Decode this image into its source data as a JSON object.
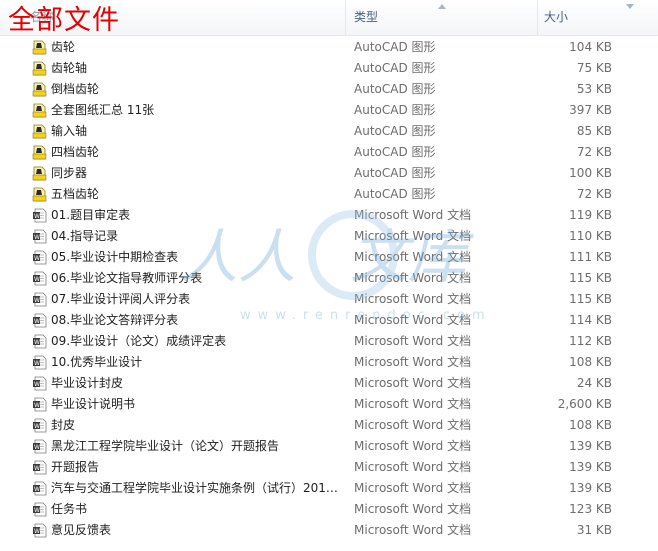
{
  "overlay_title": "全部文件",
  "columns": {
    "name": "名称",
    "type": "类型",
    "size": "大小"
  },
  "watermark": {
    "text_left": "人人",
    "text_right": "文库",
    "url": "www.renrendoc.com"
  },
  "files": [
    {
      "name": "齿轮",
      "type": "AutoCAD 图形",
      "size": "104 KB",
      "icon": "autocad-file-icon"
    },
    {
      "name": "齿轮轴",
      "type": "AutoCAD 图形",
      "size": "75 KB",
      "icon": "autocad-file-icon"
    },
    {
      "name": "倒档齿轮",
      "type": "AutoCAD 图形",
      "size": "53 KB",
      "icon": "autocad-file-icon"
    },
    {
      "name": "全套图纸汇总 11张",
      "type": "AutoCAD 图形",
      "size": "397 KB",
      "icon": "autocad-file-icon"
    },
    {
      "name": "输入轴",
      "type": "AutoCAD 图形",
      "size": "85 KB",
      "icon": "autocad-file-icon"
    },
    {
      "name": "四档齿轮",
      "type": "AutoCAD 图形",
      "size": "72 KB",
      "icon": "autocad-file-icon"
    },
    {
      "name": "同步器",
      "type": "AutoCAD 图形",
      "size": "100 KB",
      "icon": "autocad-file-icon"
    },
    {
      "name": "五档齿轮",
      "type": "AutoCAD 图形",
      "size": "72 KB",
      "icon": "autocad-file-icon"
    },
    {
      "name": "01.题目审定表",
      "type": "Microsoft Word 文档",
      "size": "119 KB",
      "icon": "word-file-icon"
    },
    {
      "name": "04.指导记录",
      "type": "Microsoft Word 文档",
      "size": "110 KB",
      "icon": "word-file-icon"
    },
    {
      "name": "05.毕业设计中期检查表",
      "type": "Microsoft Word 文档",
      "size": "111 KB",
      "icon": "word-file-icon"
    },
    {
      "name": "06.毕业论文指导教师评分表",
      "type": "Microsoft Word 文档",
      "size": "115 KB",
      "icon": "word-file-icon"
    },
    {
      "name": "07.毕业设计评阅人评分表",
      "type": "Microsoft Word 文档",
      "size": "115 KB",
      "icon": "word-file-icon"
    },
    {
      "name": "08.毕业论文答辩评分表",
      "type": "Microsoft Word 文档",
      "size": "114 KB",
      "icon": "word-file-icon"
    },
    {
      "name": "09.毕业设计（论文）成绩评定表",
      "type": "Microsoft Word 文档",
      "size": "112 KB",
      "icon": "word-file-icon"
    },
    {
      "name": "10.优秀毕业设计",
      "type": "Microsoft Word 文档",
      "size": "108 KB",
      "icon": "word-file-icon"
    },
    {
      "name": "毕业设计封皮",
      "type": "Microsoft Word 文档",
      "size": "24 KB",
      "icon": "word-file-icon"
    },
    {
      "name": "毕业设计说明书",
      "type": "Microsoft Word 文档",
      "size": "2,600 KB",
      "icon": "word-file-icon"
    },
    {
      "name": "封皮",
      "type": "Microsoft Word 文档",
      "size": "108 KB",
      "icon": "word-file-icon"
    },
    {
      "name": "黑龙江工程学院毕业设计（论文）开题报告",
      "type": "Microsoft Word 文档",
      "size": "139 KB",
      "icon": "word-file-icon"
    },
    {
      "name": "开题报告",
      "type": "Microsoft Word 文档",
      "size": "139 KB",
      "icon": "word-file-icon"
    },
    {
      "name": "汽车与交通工程学院毕业设计实施条例（试行）2011...",
      "type": "Microsoft Word 文档",
      "size": "139 KB",
      "icon": "word-file-icon"
    },
    {
      "name": "任务书",
      "type": "Microsoft Word 文档",
      "size": "123 KB",
      "icon": "word-file-icon"
    },
    {
      "name": "意见反馈表",
      "type": "Microsoft Word 文档",
      "size": "31 KB",
      "icon": "word-file-icon"
    }
  ]
}
